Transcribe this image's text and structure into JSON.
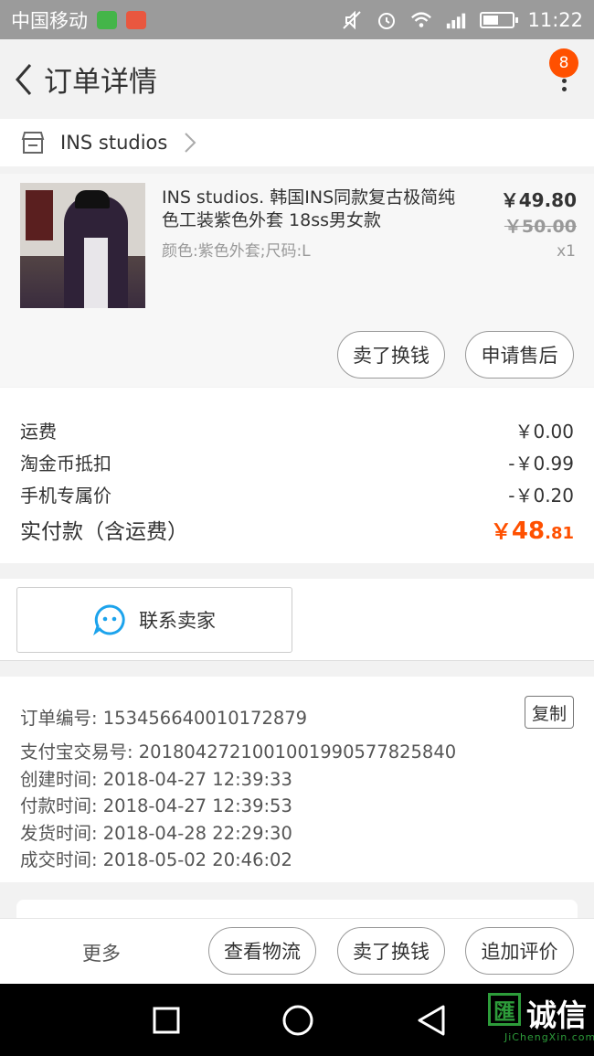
{
  "statusbar": {
    "carrier": "中国移动",
    "time": "11:22",
    "icons": [
      "wechat-icon",
      "mail-icon",
      "mute-icon",
      "alarm-icon",
      "wifi-icon",
      "signal-icon",
      "battery-icon"
    ]
  },
  "header": {
    "title": "订单详情",
    "badge_count": "8"
  },
  "shop": {
    "name": "INS studios"
  },
  "product": {
    "title": "INS studios. 韩国INS同款复古极简纯色工装紫色外套 18ss男女款",
    "spec": "颜色:紫色外套;尺码:L",
    "price": "￥49.80",
    "original_price": "￥50.00",
    "quantity": "x1",
    "buttons": {
      "sell": "卖了换钱",
      "after_sale": "申请售后"
    }
  },
  "cost": {
    "rows": [
      {
        "label": "运费",
        "value": "￥0.00"
      },
      {
        "label": "淘金币抵扣",
        "value": "-￥0.99"
      },
      {
        "label": "手机专属价",
        "value": "-￥0.20"
      }
    ],
    "total_label": "实付款（含运费）",
    "total_currency": "￥",
    "total_int": "48",
    "total_dec": ".81"
  },
  "contact": {
    "label": "联系卖家"
  },
  "order_info": {
    "order_no": "订单编号:  153456640010172879",
    "alipay_no": "支付宝交易号:  2018042721001001990577825840",
    "created": "创建时间:  2018-04-27 12:39:33",
    "paid": "付款时间:  2018-04-27 12:39:53",
    "shipped": "发货时间:  2018-04-28 22:29:30",
    "completed": "成交时间:  2018-05-02 20:46:02",
    "copy_label": "复制"
  },
  "actions": {
    "more": "更多",
    "logistics": "查看物流",
    "sell": "卖了换钱",
    "review": "追加评价"
  },
  "watermark": {
    "char": "匯",
    "cn": "诚信",
    "en": "JiChengXin.com"
  },
  "colors": {
    "accent": "#ff5000",
    "statusbar": "#9b9b9b",
    "background": "#f2f2f2"
  }
}
